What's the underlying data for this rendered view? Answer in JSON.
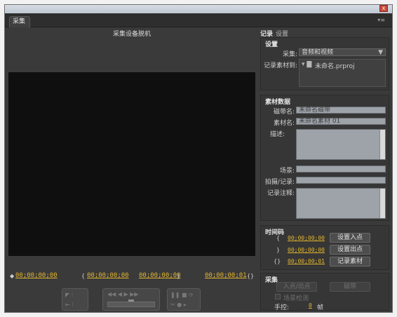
{
  "window": {
    "tab_label": "采集",
    "close_glyph": "x"
  },
  "monitor": {
    "status": "采集设备脱机",
    "timecodes": {
      "current": "00;00;00;00",
      "in": "00;00;00;00",
      "out": "00;00;00;00",
      "duration": "00;00;00;01"
    }
  },
  "panel": {
    "tabs": [
      "记录",
      "设置"
    ],
    "settings": {
      "heading": "设置",
      "capture_label": "采集:",
      "capture_value": "音频和视频",
      "log_to_label": "记录素材到:",
      "log_to_value": "未命名.prproj"
    },
    "clip_data": {
      "heading": "素材数据",
      "tape_label": "磁带名:",
      "tape_value": "未命名磁带",
      "clip_label": "素材名:",
      "clip_value": "未命名素材 01",
      "desc_label": "描述:",
      "scene_label": "场景:",
      "shot_label": "拍摄/记录:",
      "comment_label": "记录注释:"
    },
    "timecode": {
      "heading": "时间码",
      "in_tc": "00;00;00;00",
      "out_tc": "00;00;00;00",
      "dur_tc": "00;00;00;01",
      "set_in": "设置入点",
      "set_out": "设置出点",
      "log_clip": "记录素材"
    },
    "capture": {
      "heading": "采集",
      "in_out_button": "入点/出点",
      "tape_button": "磁带",
      "scene_detect": "场景检测",
      "handles_label": "手控:",
      "handles_value": "0",
      "handles_unit": "帧"
    }
  }
}
